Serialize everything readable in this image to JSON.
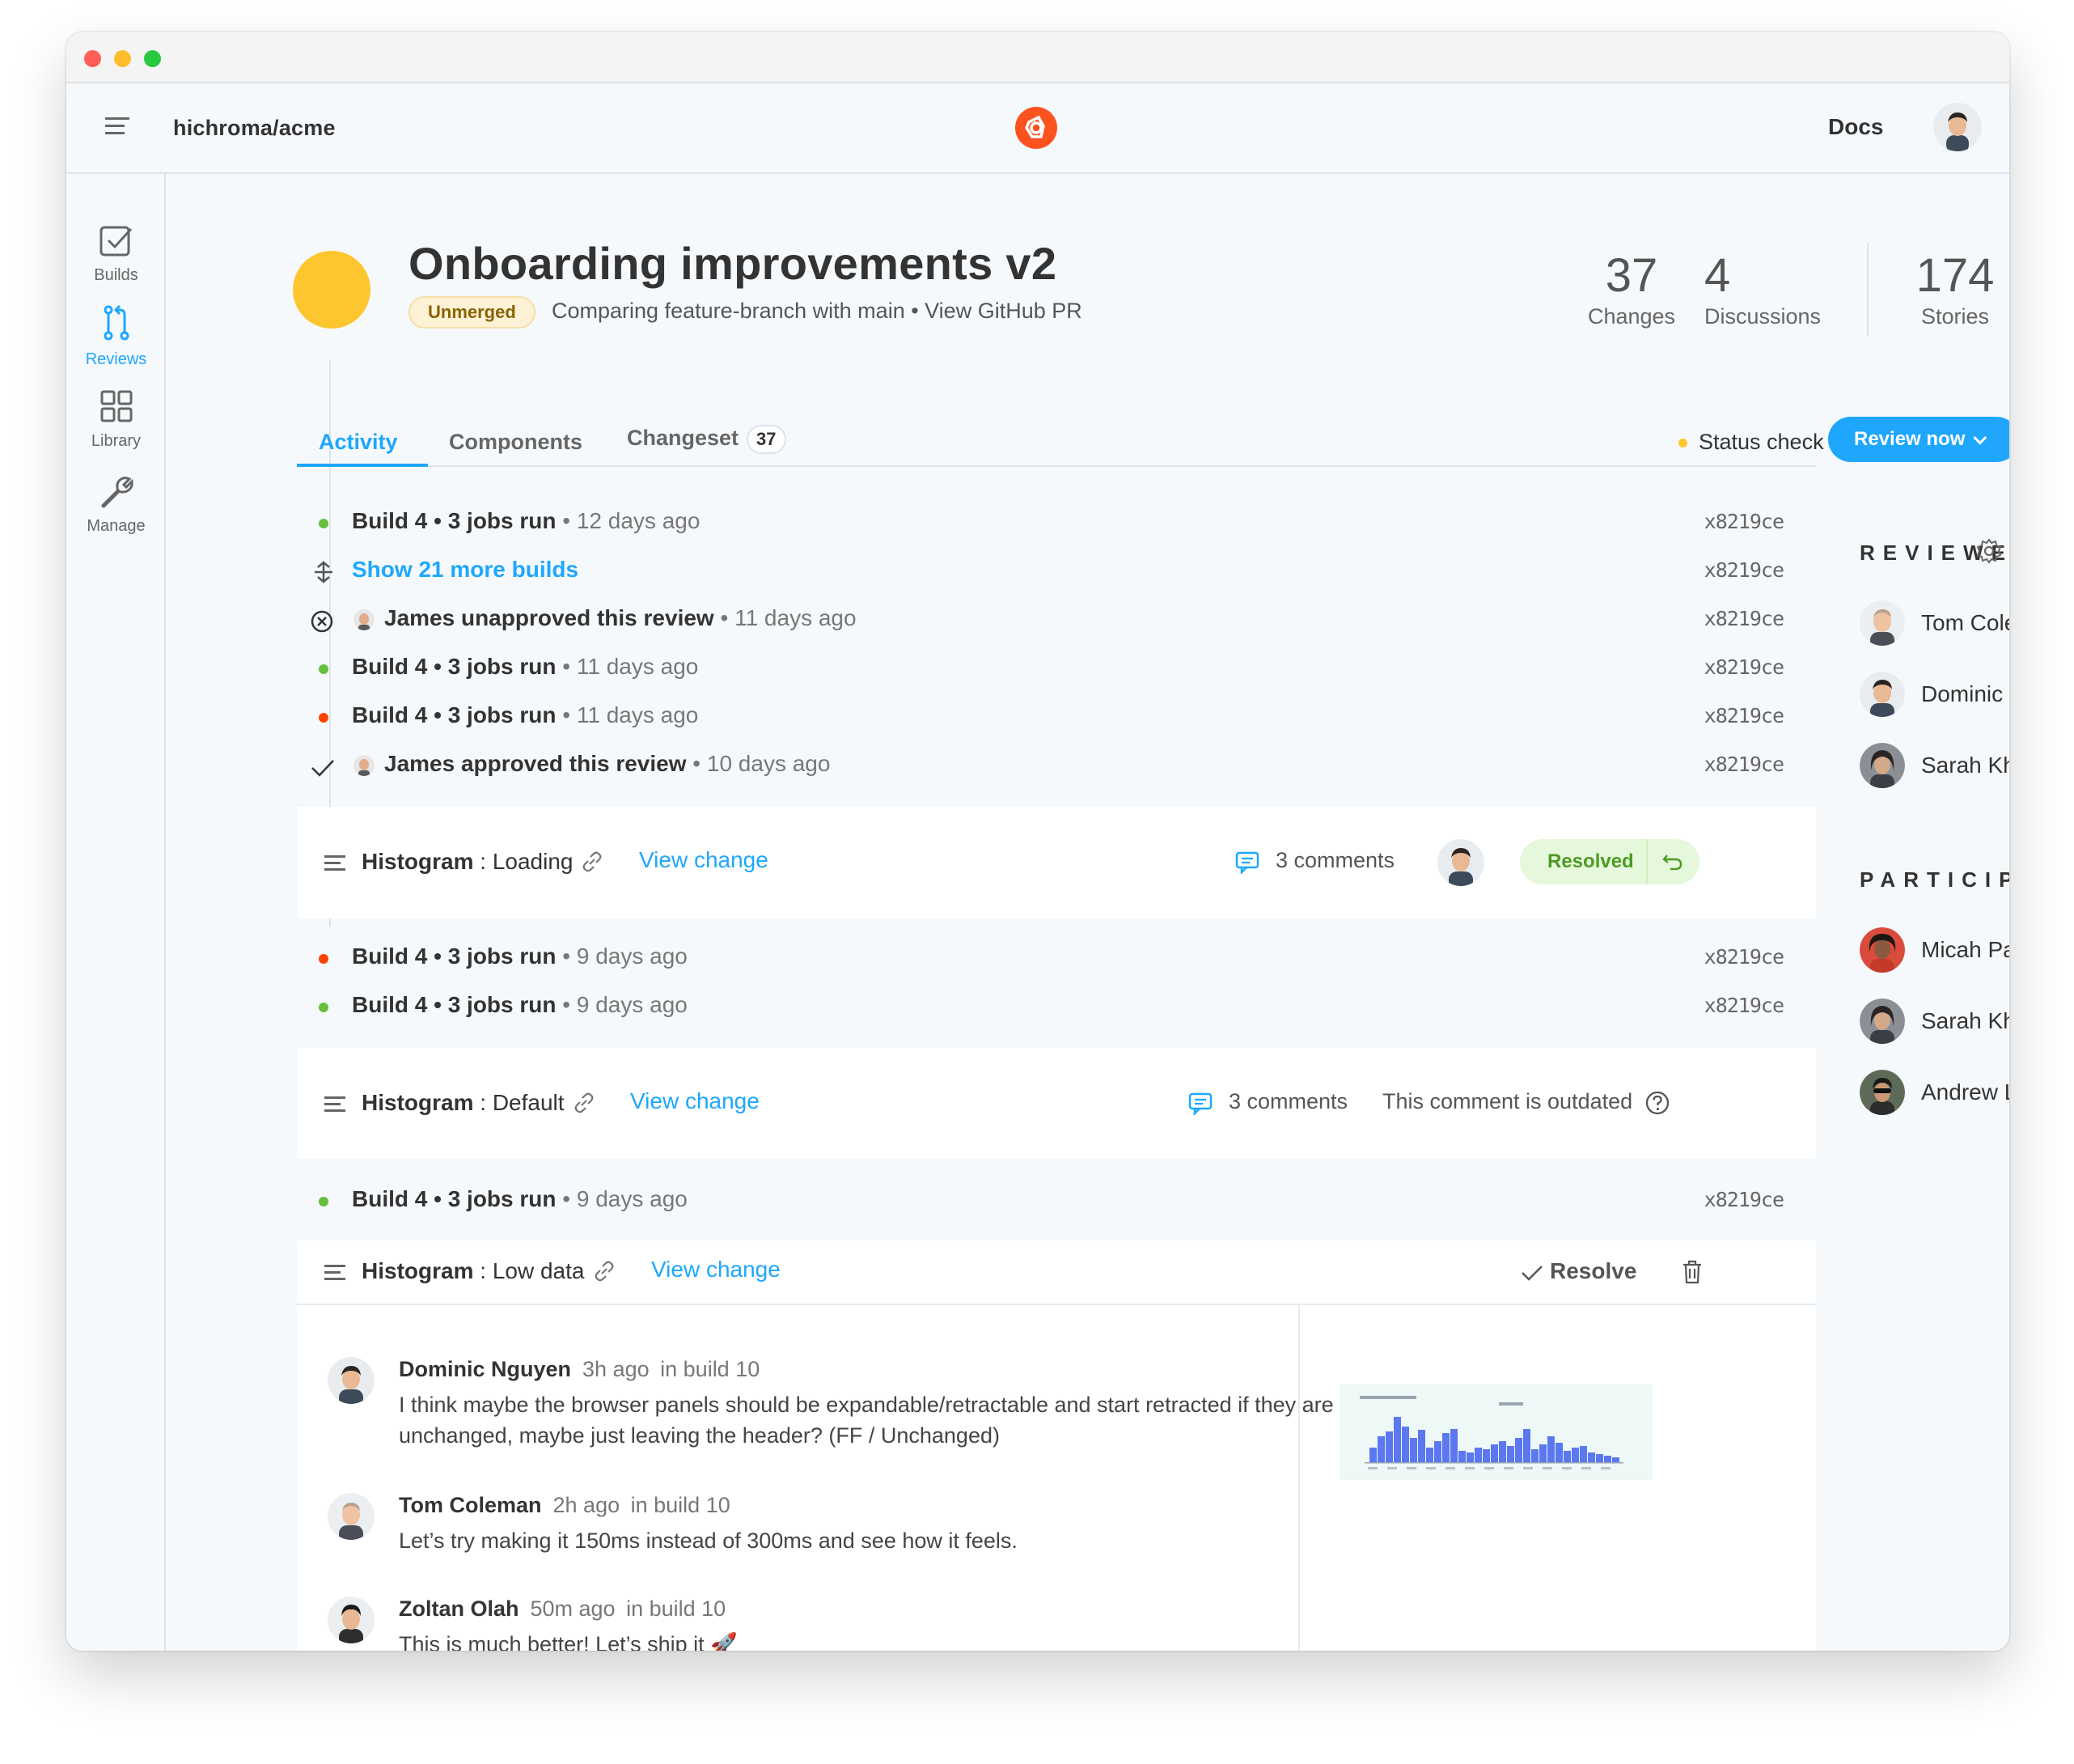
{
  "app": {
    "repo": "hichroma/acme",
    "docs_label": "Docs"
  },
  "sidebar": {
    "items": [
      {
        "label": "Builds"
      },
      {
        "label": "Reviews"
      },
      {
        "label": "Library"
      },
      {
        "label": "Manage"
      }
    ]
  },
  "header": {
    "title": "Onboarding improvements v2",
    "badge": "Unmerged",
    "subtitle": "Comparing feature-branch with main • View GitHub PR",
    "stats": [
      {
        "value": "37",
        "label": "Changes"
      },
      {
        "value": "4",
        "label": "Discussions"
      },
      {
        "value": "174",
        "label": "Stories"
      }
    ]
  },
  "tabs": [
    {
      "label": "Activity"
    },
    {
      "label": "Components"
    },
    {
      "label": "Changeset",
      "count": "37"
    }
  ],
  "actions": {
    "status_check": "Status check",
    "review_now": "Review now"
  },
  "activity": [
    {
      "type": "build",
      "status": "green",
      "title": "Build 4 • 3 jobs run",
      "time": "• 12 days ago",
      "hash": "x8219ce"
    },
    {
      "type": "more",
      "title": "Show 21 more builds",
      "hash": "x8219ce"
    },
    {
      "type": "unapproved",
      "title": "James unapproved this review",
      "time": "• 11 days ago",
      "hash": "x8219ce"
    },
    {
      "type": "build",
      "status": "green",
      "title": "Build 4 • 3 jobs run",
      "time": "• 11 days ago",
      "hash": "x8219ce"
    },
    {
      "type": "build",
      "status": "red",
      "title": "Build 4 • 3 jobs run",
      "time": "• 11 days ago",
      "hash": "x8219ce"
    },
    {
      "type": "approved",
      "title": "James approved this review",
      "time": "• 10 days ago",
      "hash": "x8219ce"
    }
  ],
  "card1": {
    "component": "Histogram",
    "story": "Loading",
    "view_change": "View change",
    "comments": "3 comments",
    "resolved": "Resolved"
  },
  "activity2": [
    {
      "type": "build",
      "status": "red",
      "title": "Build 4 • 3 jobs run",
      "time": "• 9 days ago",
      "hash": "x8219ce"
    },
    {
      "type": "build",
      "status": "green",
      "title": "Build 4 • 3 jobs run",
      "time": "• 9 days ago",
      "hash": "x8219ce"
    }
  ],
  "card2": {
    "component": "Histogram",
    "story": "Default",
    "view_change": "View change",
    "comments": "3 comments",
    "outdated": "This comment is outdated"
  },
  "activity3": [
    {
      "type": "build",
      "status": "green",
      "title": "Build 4 • 3 jobs run",
      "time": "• 9 days ago",
      "hash": "x8219ce"
    }
  ],
  "card3": {
    "component": "Histogram",
    "story": "Low data",
    "view_change": "View change",
    "resolve": "Resolve",
    "comments": [
      {
        "author": "Dominic Nguyen",
        "time": "3h ago",
        "build": "in build 10",
        "text": "I think maybe the browser panels should be expandable/retractable and start retracted if they are unchanged, maybe just leaving the header? (FF / Unchanged)"
      },
      {
        "author": "Tom Coleman",
        "time": "2h ago",
        "build": "in build 10",
        "text": "Let’s try making it 150ms instead of 300ms and see how it feels."
      },
      {
        "author": "Zoltan Olah",
        "time": "50m ago",
        "build": "in build 10",
        "text": "This is much better! Let’s ship it 🚀"
      }
    ]
  },
  "reviewers": {
    "title": "REVIEWERS",
    "people": [
      {
        "name": "Tom Coleman",
        "status": "approved"
      },
      {
        "name": "Dominic Nguyen",
        "status": "added"
      },
      {
        "name": "Sarah Khan",
        "status": "pending"
      }
    ]
  },
  "participants": {
    "title": "PARTICIPANTS",
    "people": [
      {
        "name": "Micah Parillo"
      },
      {
        "name": "Sarah Khan"
      },
      {
        "name": "Andrew Lee"
      }
    ]
  },
  "colors": {
    "accent": "#1ea7fd",
    "green": "#66bf3c",
    "red": "#ff4400",
    "yellow": "#fec62e"
  }
}
